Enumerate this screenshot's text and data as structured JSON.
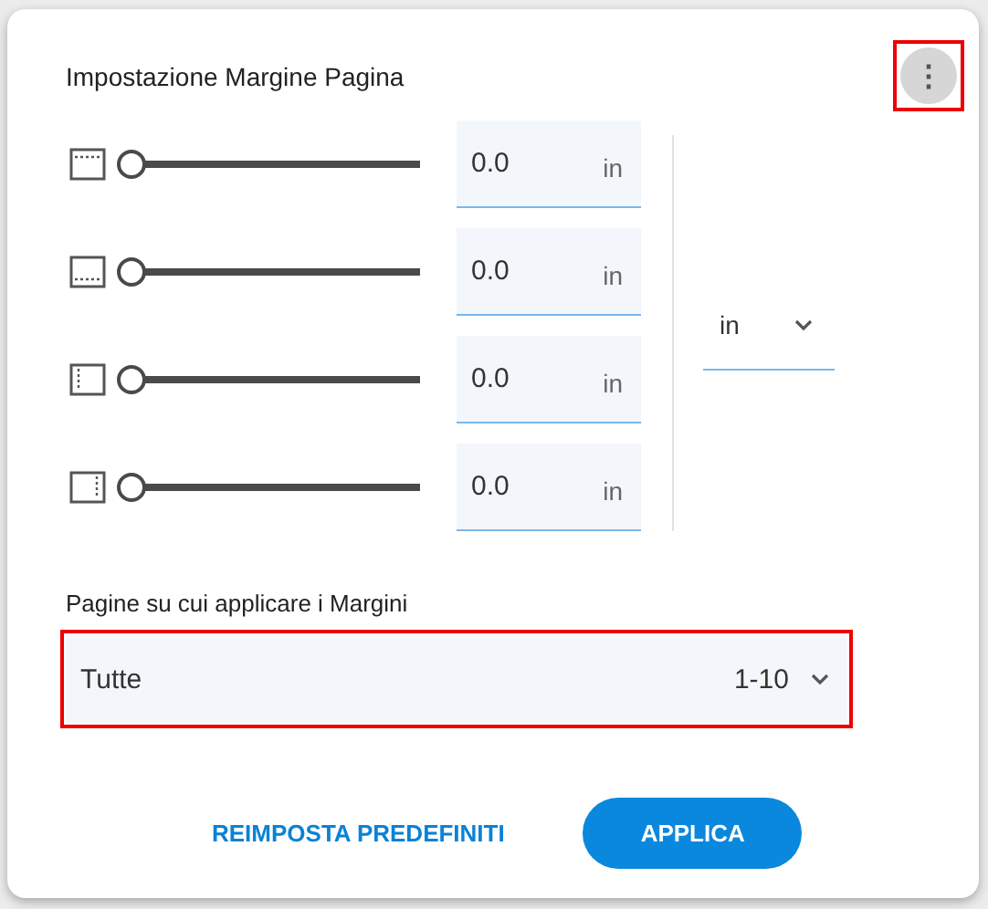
{
  "dialog": {
    "title": "Impostazione Margine Pagina",
    "more_button": {
      "label": "⋮",
      "highlighted": true
    }
  },
  "margins": [
    {
      "kind": "top",
      "level": 0,
      "value": "0.0",
      "unit": "in"
    },
    {
      "kind": "bottom",
      "level": 0,
      "value": "0.0",
      "unit": "in"
    },
    {
      "kind": "left",
      "level": 0,
      "value": "0.0",
      "unit": "in"
    },
    {
      "kind": "right",
      "level": 0,
      "value": "0.0",
      "unit": "in"
    }
  ],
  "unit_select": {
    "value": "in"
  },
  "pages": {
    "label": "Pagine su cui applicare i Margini",
    "value": "Tutte",
    "range": "1-10",
    "highlighted": true
  },
  "buttons": {
    "reset": "REIMPOSTA PREDEFINITI",
    "apply": "APPLICA"
  }
}
